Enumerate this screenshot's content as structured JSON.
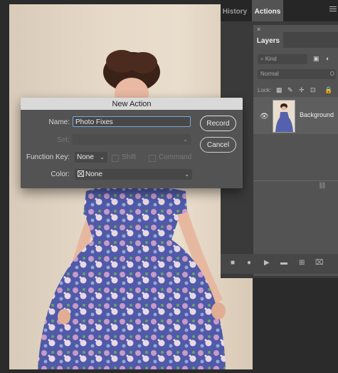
{
  "panels": {
    "tabs": [
      {
        "label": "History",
        "active": false
      },
      {
        "label": "Actions",
        "active": true
      }
    ]
  },
  "layers_panel": {
    "close_glyph": "×",
    "tab_label": "Layers",
    "filter_label": "Kind",
    "blend_mode": "Normal",
    "opacity_label": "O",
    "lock_label": "Lock:",
    "layers": [
      {
        "name": "Background",
        "visible": true
      }
    ]
  },
  "dialog": {
    "title": "New Action",
    "name_label": "Name:",
    "name_value": "Photo Fixes",
    "set_label": "Set:",
    "set_value": "",
    "function_key_label": "Function Key:",
    "function_key_value": "None",
    "shift_label": "Shift",
    "command_label": "Command",
    "color_label": "Color:",
    "color_value": "None",
    "record_label": "Record",
    "cancel_label": "Cancel"
  },
  "icons": {
    "eye": "👁",
    "chevron": "⌄",
    "link": "⛓"
  }
}
